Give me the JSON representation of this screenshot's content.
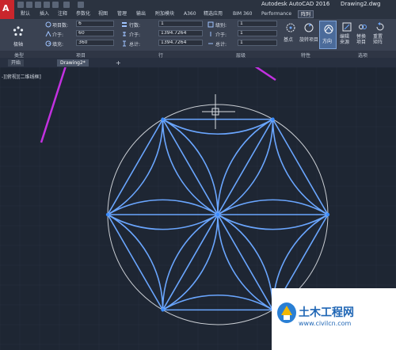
{
  "title_bar": {
    "app": "Autodesk AutoCAD 2016",
    "file": "Drawing2.dwg"
  },
  "ribbon_tabs": [
    {
      "label": "默认"
    },
    {
      "label": "插入"
    },
    {
      "label": "注释"
    },
    {
      "label": "参数化"
    },
    {
      "label": "视图"
    },
    {
      "label": "管理"
    },
    {
      "label": "输出"
    },
    {
      "label": "附加模块"
    },
    {
      "label": "A360"
    },
    {
      "label": "精选应用"
    },
    {
      "label": "BIM 360"
    },
    {
      "label": "Performance"
    },
    {
      "label": "阵列"
    }
  ],
  "panel_type": {
    "button": "极轴",
    "label": "类型"
  },
  "panel_items": {
    "label": "项目",
    "count_label": "项目数:",
    "count_value": "6",
    "between_label": "介于:",
    "between_value": "60",
    "fill_label": "填充:",
    "fill_value": "360"
  },
  "panel_rows": {
    "label": "行",
    "rows_label": "行数:",
    "rows_value": "1",
    "between_label": "介于:",
    "between_value": "1394.7264",
    "total_label": "总计:",
    "total_value": "1394.7264"
  },
  "panel_levels": {
    "label": "层级",
    "levels_label": "级别:",
    "levels_value": "1",
    "between_label": "介于:",
    "between_value": "1",
    "total_label": "总计:",
    "total_value": "1"
  },
  "panel_properties": {
    "label": "特性",
    "associative": "关联",
    "base_point": "基点",
    "rotate_items": "旋转项目",
    "direction": "方向"
  },
  "panel_options": {
    "label": "选项",
    "edit_source": "编辑\n来源",
    "replace_item": "替换\n项目",
    "reset_array": "重置\n矩阵"
  },
  "doc_tabs": [
    {
      "label": "开始"
    },
    {
      "label": "Drawing2*"
    }
  ],
  "viewport_label": "-][俯视][二维线框]",
  "watermark": {
    "title": "土木工程网",
    "url": "www.civilcn.com"
  },
  "colors": {
    "accent": "#c231e0",
    "geometry": "#6aa6ff",
    "circle": "#c9cdd3"
  }
}
